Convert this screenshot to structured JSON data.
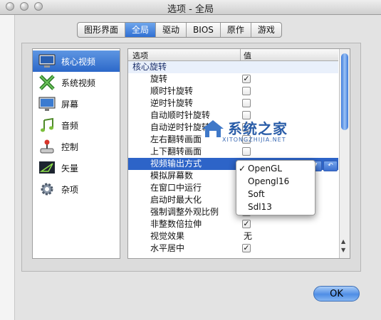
{
  "window": {
    "title": "选项 - 全局"
  },
  "tabs": [
    {
      "label": "图形界面",
      "active": false
    },
    {
      "label": "全局",
      "active": true
    },
    {
      "label": "驱动",
      "active": false
    },
    {
      "label": "BIOS",
      "active": false
    },
    {
      "label": "原作",
      "active": false
    },
    {
      "label": "游戏",
      "active": false
    }
  ],
  "sidebar": {
    "items": [
      {
        "label": "核心视频",
        "icon": "monitor-icon",
        "selected": true
      },
      {
        "label": "系统视频",
        "icon": "x-logo-icon",
        "selected": false
      },
      {
        "label": "屏幕",
        "icon": "screen-icon",
        "selected": false
      },
      {
        "label": "音频",
        "icon": "music-note-icon",
        "selected": false
      },
      {
        "label": "控制",
        "icon": "joystick-icon",
        "selected": false
      },
      {
        "label": "矢量",
        "icon": "vector-icon",
        "selected": false
      },
      {
        "label": "杂项",
        "icon": "gear-icon",
        "selected": false
      }
    ]
  },
  "table": {
    "headers": {
      "option": "选项",
      "value": "值"
    },
    "rows": [
      {
        "label": "核心旋转",
        "type": "group"
      },
      {
        "label": "旋转",
        "type": "checkbox",
        "checked": true
      },
      {
        "label": "顺时针旋转",
        "type": "checkbox",
        "checked": false
      },
      {
        "label": "逆时针旋转",
        "type": "checkbox",
        "checked": false
      },
      {
        "label": "自动顺时针旋转",
        "type": "checkbox",
        "checked": false
      },
      {
        "label": "自动逆时针旋转",
        "type": "checkbox",
        "checked": false
      },
      {
        "label": "左右翻转画面",
        "type": "checkbox",
        "checked": false
      },
      {
        "label": "上下翻转画面",
        "type": "checkbox",
        "checked": false
      },
      {
        "label": "视频输出方式",
        "type": "select",
        "selected": true
      },
      {
        "label": "模拟屏幕数",
        "type": "text",
        "value": ""
      },
      {
        "label": "在窗口中运行",
        "type": "checkbox",
        "checked": false
      },
      {
        "label": "启动时最大化",
        "type": "checkbox",
        "checked": false
      },
      {
        "label": "强制调整外观比例",
        "type": "checkbox",
        "checked": true
      },
      {
        "label": "非整数倍拉伸",
        "type": "checkbox",
        "checked": true
      },
      {
        "label": "视觉效果",
        "type": "text",
        "value": "无"
      },
      {
        "label": "水平居中",
        "type": "checkbox",
        "checked": true
      }
    ]
  },
  "dropdown": {
    "options": [
      {
        "label": "OpenGL",
        "checked": true
      },
      {
        "label": "Opengl16",
        "checked": false
      },
      {
        "label": "Soft",
        "checked": false
      },
      {
        "label": "Sdl13",
        "checked": false
      }
    ],
    "check_mark": "✓"
  },
  "inline_buttons": {
    "dropdown_glyph": "▼",
    "reset_glyph": "↶"
  },
  "watermark": {
    "title": "系统之家",
    "subtitle": "XITONGZHIJIA.NET"
  },
  "ok_button": {
    "label": "OK"
  },
  "colors": {
    "accent": "#2d64c8",
    "selection": "#2d64c8",
    "group_bg": "#e9f0fb"
  }
}
